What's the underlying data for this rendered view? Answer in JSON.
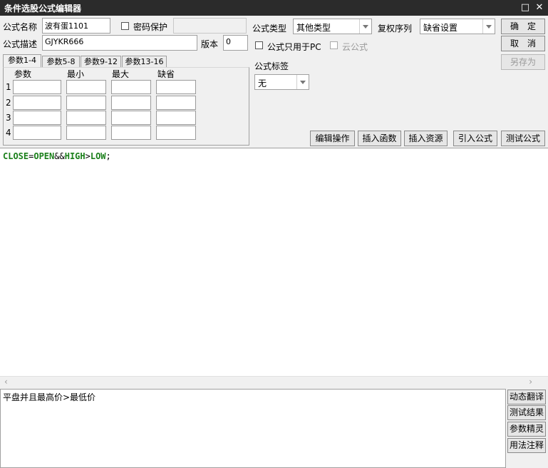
{
  "window": {
    "title": "条件选股公式编辑器",
    "maximize_icon": "□",
    "close_icon": "✕"
  },
  "form": {
    "name_label": "公式名称",
    "name_value": "波有蛋1101",
    "password_label": "密码保护",
    "desc_label": "公式描述",
    "desc_value": "GJYKR666",
    "version_label": "版本",
    "version_value": "0",
    "type_label": "公式类型",
    "type_value": "其他类型",
    "rights_label": "复权序列",
    "rights_value": "缺省设置",
    "pc_only_label": "公式只用于PC",
    "cloud_label": "云公式",
    "tag_label": "公式标签",
    "tag_value": "无"
  },
  "buttons": {
    "ok": "确　定",
    "cancel": "取　消",
    "save_as": "另存为"
  },
  "tabs": [
    "参数1-4",
    "参数5-8",
    "参数9-12",
    "参数13-16"
  ],
  "param_headers": [
    "参数",
    "最小",
    "最大",
    "缺省"
  ],
  "param_rows": [
    "1",
    "2",
    "3",
    "4"
  ],
  "toolbar": {
    "edit_ops": "编辑操作",
    "insert_func": "插入函数",
    "insert_res": "插入资源",
    "import_formula": "引入公式",
    "test_formula": "测试公式"
  },
  "code": {
    "t1": "CLOSE",
    "t2": "=",
    "t3": "OPEN",
    "t4": "&&",
    "t5": "HIGH",
    "t6": ">",
    "t7": "LOW",
    "t8": ";"
  },
  "scroll": {
    "left": "‹",
    "right": "›"
  },
  "description_text": "平盘并且最高价>最低价",
  "side_buttons": [
    "动态翻译",
    "测试结果",
    "参数精灵",
    "用法注释"
  ]
}
